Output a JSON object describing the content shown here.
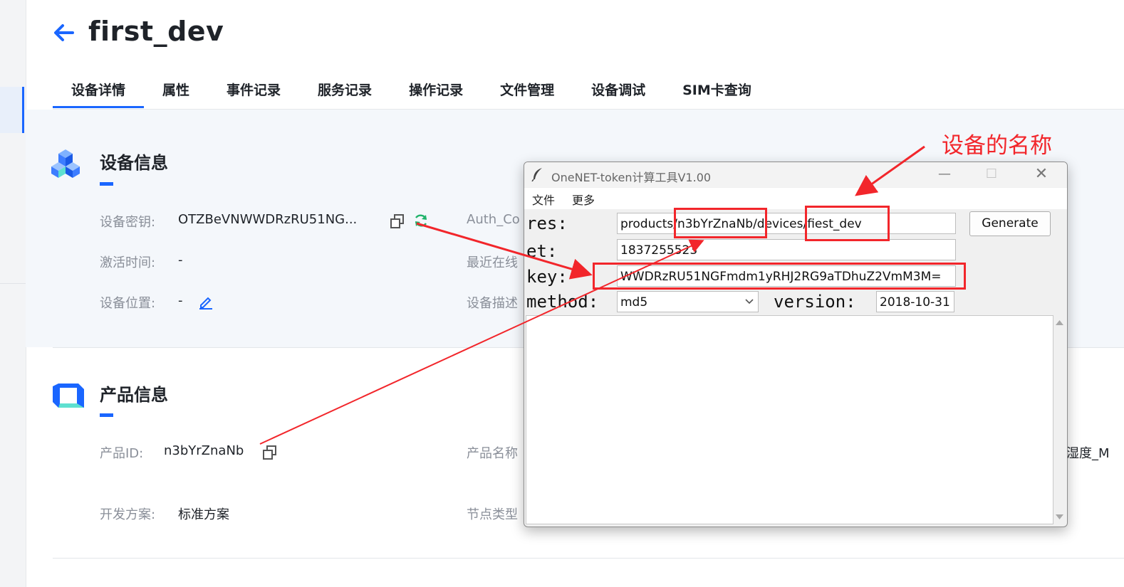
{
  "header": {
    "title": "first_dev"
  },
  "tabs": [
    {
      "label": "设备详情",
      "active": true
    },
    {
      "label": "属性"
    },
    {
      "label": "事件记录"
    },
    {
      "label": "服务记录"
    },
    {
      "label": "操作记录"
    },
    {
      "label": "文件管理"
    },
    {
      "label": "设备调试"
    },
    {
      "label": "SIM卡查询"
    }
  ],
  "device_info": {
    "title": "设备信息",
    "secret_label": "设备密钥:",
    "secret_value": "OTZBeVNWWDRzRU51NG...",
    "auth_label": "Auth_Co",
    "activate_label": "激活时间:",
    "activate_value": "-",
    "last_online_label": "最近在线",
    "location_label": "设备位置:",
    "location_value": "-",
    "desc_label": "设备描述"
  },
  "product_info": {
    "title": "产品信息",
    "id_label": "产品ID:",
    "id_value": "n3bYrZnaNb",
    "name_label": "产品名称",
    "name_value_partial": "湿度_M",
    "scheme_label": "开发方案:",
    "scheme_value": "标准方案",
    "node_label": "节点类型"
  },
  "tool_window": {
    "title": "OneNET-token计算工具V1.00",
    "menu": [
      "文件",
      "更多"
    ],
    "res_label": "res:",
    "res_value": "products/n3bYrZnaNb/devices/fiest_dev",
    "et_label": "et:",
    "et_value": "1837255523",
    "key_label": "key:",
    "key_value": "WWDRzRU51NGFmdm1yRHJ2RG9aTDhuZ2VmM3M=",
    "method_label": "method:",
    "method_value": "md5",
    "version_label": "version:",
    "version_value": "2018-10-31",
    "generate_label": "Generate"
  },
  "annotation": {
    "text": "设备的名称",
    "color": "#f2262b"
  },
  "colors": {
    "accent": "#1a66ff",
    "annotation": "#f2262b"
  }
}
